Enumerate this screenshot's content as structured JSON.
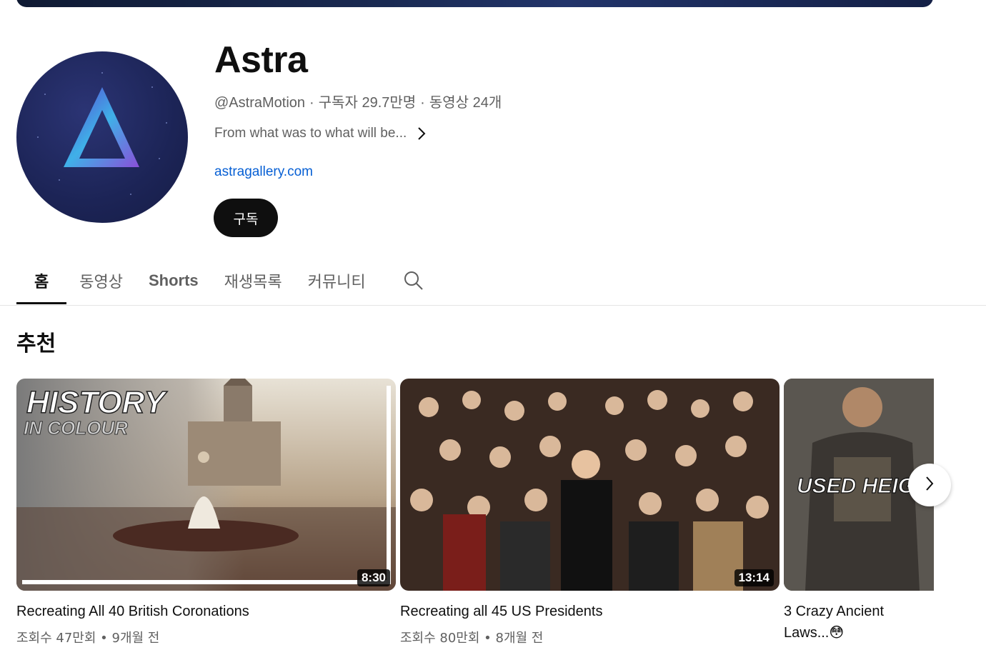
{
  "channel": {
    "name": "Astra",
    "handle": "@AstraMotion",
    "subscribers": "구독자 29.7만명",
    "video_count": "동영상 24개",
    "description": "From what was to what will be...",
    "link": "astragallery.com",
    "subscribe_label": "구독",
    "separator": "·"
  },
  "tabs": [
    {
      "label": "홈",
      "active": true
    },
    {
      "label": "동영상"
    },
    {
      "label": "Shorts"
    },
    {
      "label": "재생목록"
    },
    {
      "label": "커뮤니티"
    }
  ],
  "section": {
    "title": "추천"
  },
  "videos": [
    {
      "title": "Recreating All 40 British Coronations",
      "meta": "조회수 47만회 • 9개월 전",
      "duration": "8:30",
      "overlay_text": [
        "HISTORY",
        "IN COLOUR"
      ]
    },
    {
      "title": "Recreating all 45 US Presidents",
      "meta": "조회수 80만회 • 8개월 전",
      "duration": "13:14"
    },
    {
      "title": "3 Crazy Ancient Laws...😳",
      "overlay_text": [
        "USED HEIGH"
      ]
    }
  ],
  "icons": {
    "search": "search-icon",
    "next": "chevron-right-icon",
    "desc_more": "chevron-right-icon"
  },
  "colors": {
    "link": "#065fd4",
    "subscribe_bg": "#0f0f0f",
    "muted": "#606060"
  }
}
